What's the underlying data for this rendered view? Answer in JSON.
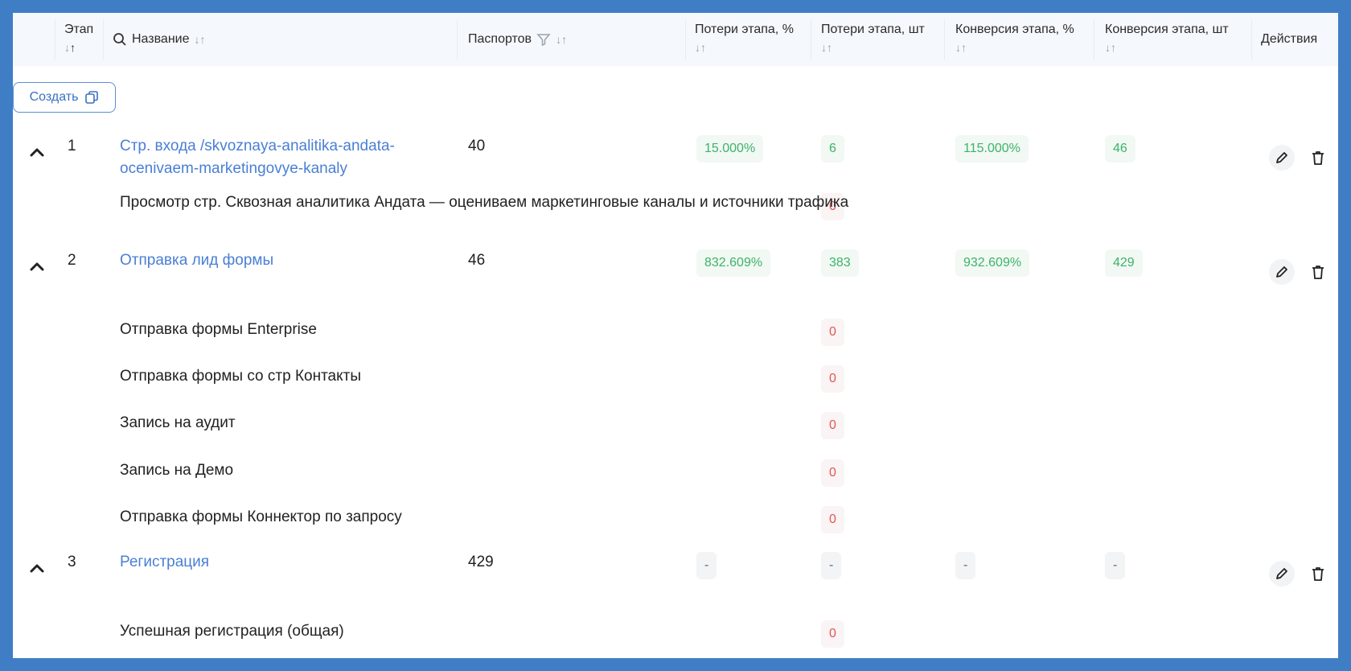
{
  "headers": {
    "stage": "Этап",
    "name": "Название",
    "passports": "Паспортов",
    "loss_pct": "Потери этапа, %",
    "loss_qty": "Потери этапа, шт",
    "conv_pct": "Конверсия этапа, %",
    "conv_qty": "Конверсия этапа, шт",
    "actions": "Действия"
  },
  "create_label": "Создать",
  "stages": [
    {
      "num": "1",
      "name_line1": "Стр. входа /skvoznaya-analitika-andata-",
      "name_line2": "ocenivaem-marketingovye-kanaly",
      "passports": "40",
      "loss_pct": "15.000%",
      "loss_qty": "6",
      "conv_pct": "115.000%",
      "conv_qty": "46",
      "events": [
        {
          "name": "Просмотр стр. Сквозная аналитика Андата — оцениваем маркетинговые каналы и источники трафика",
          "value": "0"
        }
      ]
    },
    {
      "num": "2",
      "name_line1": "Отправка лид формы",
      "passports": "46",
      "loss_pct": "832.609%",
      "loss_qty": "383",
      "conv_pct": "932.609%",
      "conv_qty": "429",
      "events": [
        {
          "name": "Отправка формы Enterprise",
          "value": "0"
        },
        {
          "name": "Отправка формы со стр Контакты",
          "value": "0"
        },
        {
          "name": "Запись на аудит",
          "value": "0"
        },
        {
          "name": "Запись на Демо",
          "value": "0"
        },
        {
          "name": "Отправка формы Коннектор по запросу",
          "value": "0"
        }
      ]
    },
    {
      "num": "3",
      "name_line1": "Регистрация",
      "passports": "429",
      "loss_pct": "-",
      "loss_qty": "-",
      "conv_pct": "-",
      "conv_qty": "-",
      "events": [
        {
          "name": "Успешная регистрация (общая)",
          "value": "0"
        }
      ]
    }
  ],
  "icons": {
    "sort": "sort-icon",
    "search": "search-icon",
    "filter": "filter-icon",
    "collapse": "chevron-up-icon",
    "edit": "pencil-icon",
    "delete": "trash-icon",
    "copy": "copy-icon"
  },
  "colors": {
    "link": "#4a7fd4",
    "positive": "#3bb46a",
    "negative": "#e05757",
    "frame": "#3f7ec5"
  }
}
